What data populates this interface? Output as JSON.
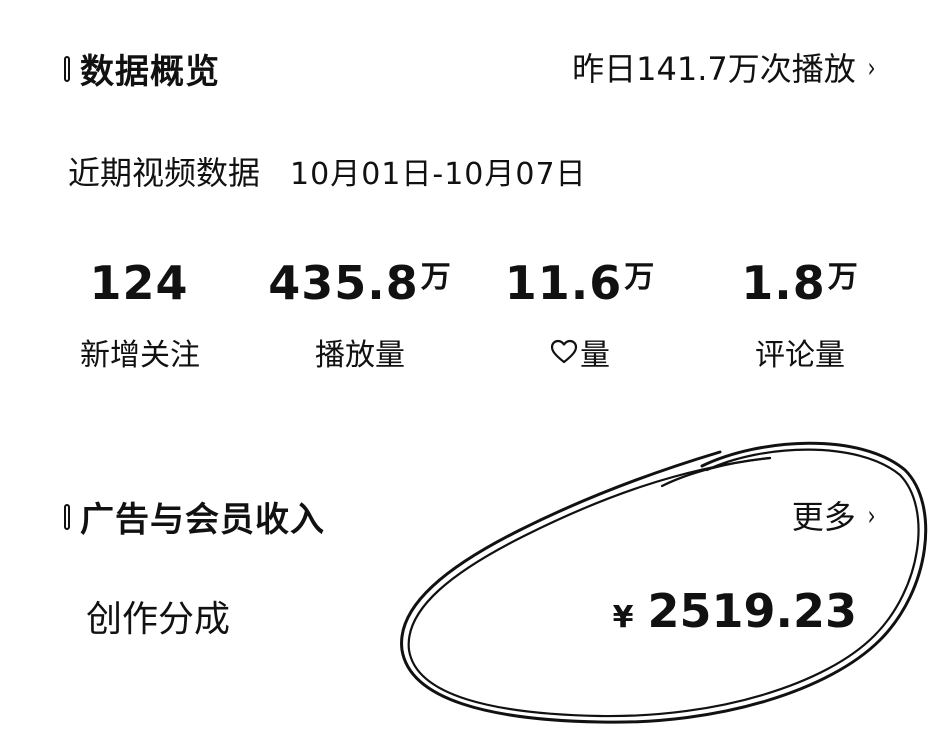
{
  "overview": {
    "title": "数据概览",
    "link_label": "昨日141.7万次播放",
    "link_chevron": "›"
  },
  "recent": {
    "label": "近期视频数据",
    "date_range": "10月01日-10月07日"
  },
  "stats": [
    {
      "value": "124",
      "unit": "",
      "label": "新增关注",
      "icon": ""
    },
    {
      "value": "435.8",
      "unit": "万",
      "label": "播放量",
      "icon": ""
    },
    {
      "value": "11.6",
      "unit": "万",
      "label": "量",
      "icon": "heart-icon"
    },
    {
      "value": "1.8",
      "unit": "万",
      "label": "评论量",
      "icon": ""
    }
  ],
  "ads": {
    "title": "广告与会员收入",
    "more_label": "更多",
    "more_chevron": "›"
  },
  "income": {
    "label": "创作分成",
    "currency": "¥",
    "amount": "2519.23"
  }
}
